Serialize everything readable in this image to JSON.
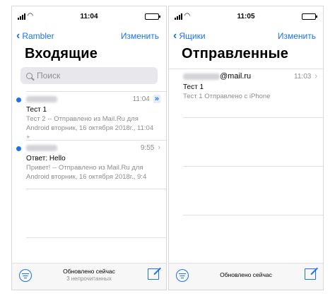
{
  "left": {
    "status_time": "11:04",
    "nav": {
      "back_label": "Rambler",
      "edit_label": "Изменить"
    },
    "title": "Входящие",
    "search": {
      "placeholder": "Поиск"
    },
    "messages": [
      {
        "time": "11:04",
        "subject": "Тест 1",
        "preview": "Тест 2 -- Отправлено из Mail.Ru для Android вторник, 16 октября 2018г., 11:04 +",
        "unread": true,
        "flagged": true
      },
      {
        "time": "9:55",
        "subject": "Ответ: Hello",
        "preview": "Привет! -- Отправлено из Mail.Ru для Android вторник, 16 октября 2018г., 9:4",
        "unread": true,
        "flagged": false
      }
    ],
    "toolbar": {
      "status": "Обновлено сейчас",
      "unread_count": "3 непрочитанных"
    }
  },
  "right": {
    "status_time": "11:05",
    "nav": {
      "back_label": "Ящики",
      "edit_label": "Изменить"
    },
    "title": "Отправленные",
    "messages": [
      {
        "sender_suffix": "@mail.ru",
        "time": "11:03",
        "subject": "Тест 1",
        "preview": "Тест 1 Отправлено с iPhone"
      }
    ],
    "toolbar": {
      "status": "Обновлено сейчас"
    }
  },
  "colors": {
    "accent": "#1a73e8",
    "secondary_text": "#8e8e93",
    "separator": "#e0e0e4"
  },
  "icons": {
    "back": "chevron-left-icon",
    "search": "search-icon",
    "unread": "unread-dot-icon",
    "disclosure": "chevron-right-icon",
    "filter": "filter-icon",
    "compose": "compose-icon"
  }
}
